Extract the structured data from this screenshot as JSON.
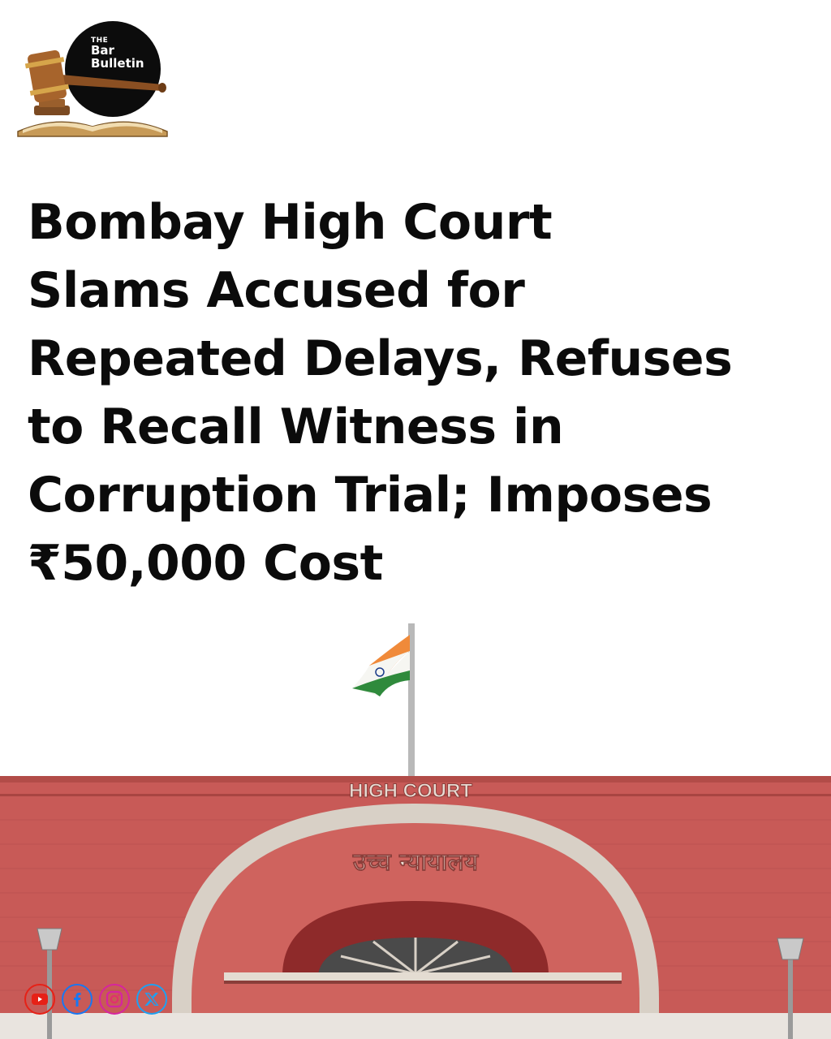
{
  "brand": {
    "line1": "THE",
    "line2": "Bar",
    "line3": "Bulletin"
  },
  "headline": {
    "lines": [
      "Bombay High Court",
      "Slams Accused for",
      "Repeated Delays, Refuses",
      "to Recall Witness in",
      "Corruption Trial; Imposes",
      "₹50,000 Cost"
    ]
  },
  "building_sign": {
    "english": "HIGH COURT",
    "hindi": "उच्च न्यायालय"
  },
  "social": [
    {
      "icon": "youtube-icon",
      "color": "#e62117"
    },
    {
      "icon": "facebook-icon",
      "color": "#1877f2"
    },
    {
      "icon": "instagram-icon",
      "color": "#d6249f"
    },
    {
      "icon": "x-icon",
      "color": "#1da1f2"
    }
  ]
}
